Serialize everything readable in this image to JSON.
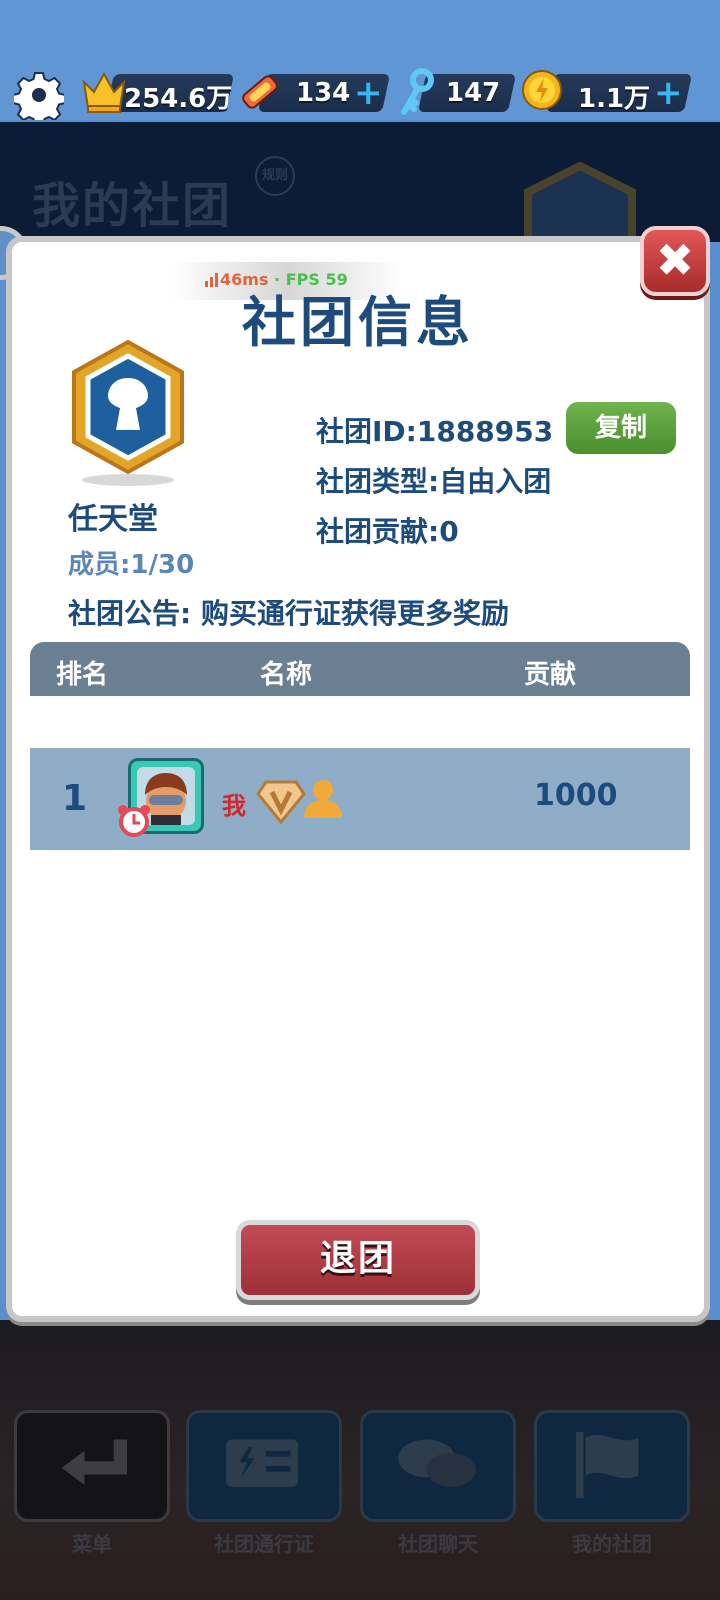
{
  "topbar": {
    "crown_value": "254.6万",
    "ticket_value": "134",
    "key_value": "147",
    "coin_value": "1.1万",
    "plus_label": "+"
  },
  "background": {
    "title": "我的社团",
    "rule_label": "规则"
  },
  "debug": {
    "latency": "46ms",
    "separator": "·",
    "fps": "FPS 59"
  },
  "panel": {
    "title": "社团信息",
    "close_label": "✖",
    "club": {
      "name": "任天堂",
      "members": "成员:1/30",
      "id_line": "社团ID:1888953",
      "copy_label": "复制",
      "type_line": "社团类型:自由入团",
      "contribution_line": "社团贡献:0",
      "notice": "社团公告: 购买通行证获得更多奖励"
    },
    "table": {
      "headers": [
        "排名",
        "名称",
        "贡献"
      ],
      "rows": [
        {
          "rank": "1",
          "name": "我",
          "contribution": "1000"
        }
      ]
    },
    "quit_label": "退团"
  },
  "bottom_nav": [
    {
      "label": "菜单"
    },
    {
      "label": "社团通行证"
    },
    {
      "label": "社团聊天"
    },
    {
      "label": "我的社团"
    }
  ],
  "colors": {
    "title_blue": "#1d4b7c",
    "copy_green": "#5aa13b",
    "quit_red": "#b23f49",
    "close_red": "#c94040",
    "row_blue": "#90adc8",
    "header_gray": "#6b7f93"
  }
}
